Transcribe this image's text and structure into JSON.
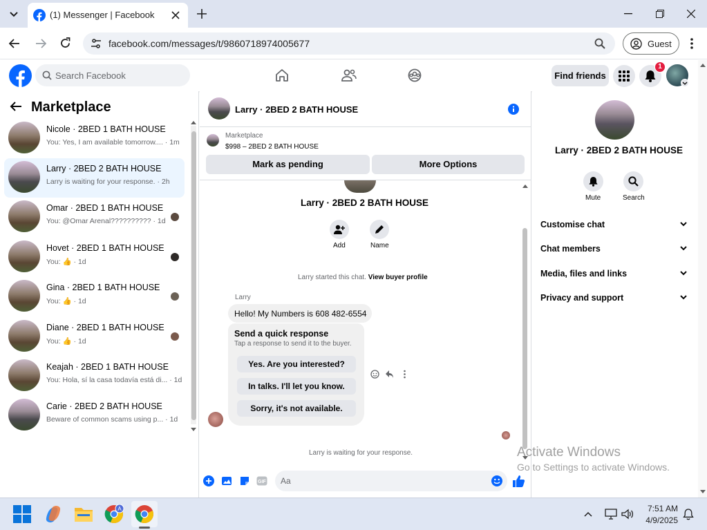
{
  "browser": {
    "tab_title": "(1) Messenger | Facebook",
    "url": "facebook.com/messages/t/9860718974005677",
    "profile_label": "Guest"
  },
  "fb_header": {
    "search_placeholder": "Search Facebook",
    "find_friends": "Find friends",
    "notification_count": "1"
  },
  "left": {
    "title": "Marketplace",
    "conversations": [
      {
        "name": "Nicole · 2BED 1 BATH HOUSE",
        "snippet": "You: Yes, I am available tomorrow.... · 1m",
        "active": false
      },
      {
        "name": "Larry · 2BED 2 BATH HOUSE",
        "snippet": "Larry is waiting for your response. · 2h",
        "active": true
      },
      {
        "name": "Omar · 2BED 1 BATH HOUSE",
        "snippet": "You: @Omar Arenal?????????? · 1d",
        "active": false
      },
      {
        "name": "Hovet · 2BED 1 BATH HOUSE",
        "snippet": "You: 👍 · 1d",
        "active": false
      },
      {
        "name": "Gina · 2BED 1 BATH HOUSE",
        "snippet": "You: 👍 · 1d",
        "active": false
      },
      {
        "name": "Diane · 2BED 1 BATH HOUSE",
        "snippet": "You: 👍 · 1d",
        "active": false
      },
      {
        "name": "Keajah · 2BED 1 BATH HOUSE",
        "snippet": "You: Hola, sí la casa todavía está di... · 1d",
        "active": false
      },
      {
        "name": "Carie · 2BED 2 BATH HOUSE",
        "snippet": "Beware of common scams using p... · 1d",
        "active": false
      }
    ]
  },
  "chat": {
    "title": "Larry · 2BED 2 BATH HOUSE",
    "listing_source": "Marketplace",
    "listing": "$998 – 2BED 2 BATH HOUSE",
    "mark_pending": "Mark as pending",
    "more_options": "More Options",
    "profile_name": "Larry · 2BED 2 BATH HOUSE",
    "add_label": "Add",
    "name_label": "Name",
    "started_text": "Larry started this chat.",
    "buyer_profile_link": "View buyer profile",
    "sender": "Larry",
    "message": "Hello! My Numbers is 608 482-6554",
    "quick_title": "Send a quick response",
    "quick_sub": "Tap a response to send it to the buyer.",
    "quick_responses": [
      "Yes. Are you interested?",
      "In talks. I'll let you know.",
      "Sorry, it's not available."
    ],
    "waiting_text": "Larry is waiting for your response.",
    "composer_placeholder": "Aa"
  },
  "right": {
    "name": "Larry · 2BED 2 BATH HOUSE",
    "mute": "Mute",
    "search": "Search",
    "sections": [
      "Customise chat",
      "Chat members",
      "Media, files and links",
      "Privacy and support"
    ]
  },
  "watermark": {
    "line1": "Activate Windows",
    "line2": "Go to Settings to activate Windows."
  },
  "taskbar": {
    "time": "7:51 AM",
    "date": "4/9/2025"
  },
  "colors": {
    "fb_blue": "#0866ff",
    "active_row": "#ebf5ff",
    "badge_red": "#e41e3f"
  }
}
